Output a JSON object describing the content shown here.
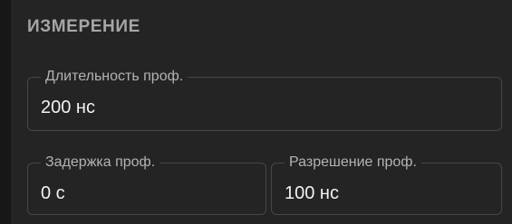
{
  "section": {
    "title": "ИЗМЕРЕНИЕ"
  },
  "fields": [
    {
      "label": "Длительность проф.",
      "value": "200 нс"
    },
    {
      "label": "Задержка проф.",
      "value": "0 с"
    },
    {
      "label": "Разрешение проф.",
      "value": "100 нс"
    }
  ]
}
